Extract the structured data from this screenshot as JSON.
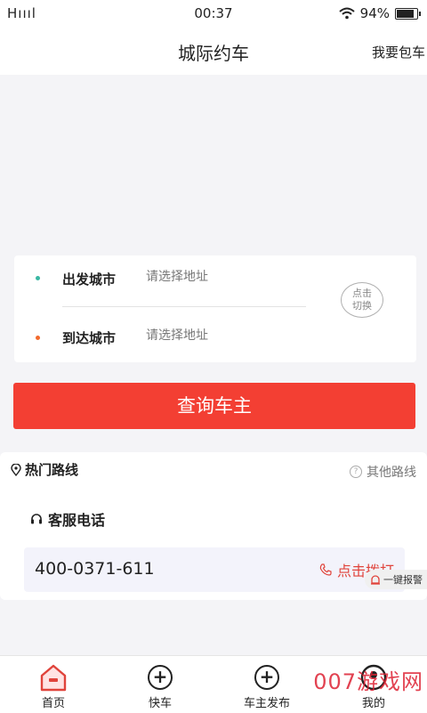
{
  "status_bar": {
    "carrier": "Hıııl",
    "time": "00:37",
    "battery": "94%"
  },
  "nav": {
    "title": "城际约车",
    "action": "我要包车"
  },
  "search": {
    "start_label": "出发城市",
    "start_placeholder": "请选择地址",
    "end_label": "到达城市",
    "end_placeholder": "请选择地址",
    "swap_line1": "点击",
    "swap_line2": "切换"
  },
  "query_button": "查询车主",
  "routes": {
    "hot_label": "热门路线",
    "other_label": "其他路线"
  },
  "service": {
    "title": "客服电话",
    "phone": "400-0371-611",
    "call_label": "点击拨打"
  },
  "alarm": "一键报警",
  "tabs": [
    {
      "label": "首页",
      "icon": "home-icon",
      "active": true
    },
    {
      "label": "快车",
      "icon": "add-circle-icon"
    },
    {
      "label": "车主发布",
      "icon": "add-circle-icon"
    },
    {
      "label": "我的",
      "icon": "user-icon"
    }
  ],
  "watermark": "007游戏网",
  "colors": {
    "accent": "#f33f33",
    "start_dot": "#39b7a3",
    "end_dot": "#f26a2d"
  }
}
